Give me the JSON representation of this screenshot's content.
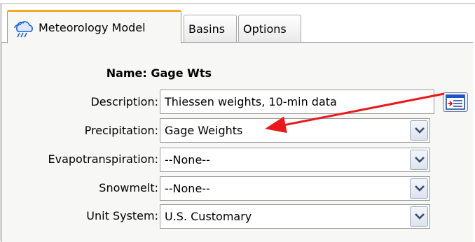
{
  "tabs": [
    {
      "label": "Meteorology Model",
      "icon": "meteorology-icon",
      "active": true
    },
    {
      "label": "Basins",
      "active": false
    },
    {
      "label": "Options",
      "active": false
    }
  ],
  "form": {
    "name_label": "Name:",
    "name_value": "Gage Wts",
    "description_label": "Description:",
    "description_value": "Thiessen weights, 10-min data",
    "precipitation_label": "Precipitation:",
    "precipitation_value": "Gage Weights",
    "evapotranspiration_label": "Evapotranspiration:",
    "evapotranspiration_value": "--None--",
    "snowmelt_label": "Snowmelt:",
    "snowmelt_value": "--None--",
    "unit_system_label": "Unit System:",
    "unit_system_value": "U.S. Customary"
  },
  "icons": {
    "description_editor": "description-editor-icon",
    "dropdown": "chevron-down-icon"
  },
  "colors": {
    "active_tab_accent": "#f5a623",
    "annotation_arrow": "#e8191b"
  }
}
